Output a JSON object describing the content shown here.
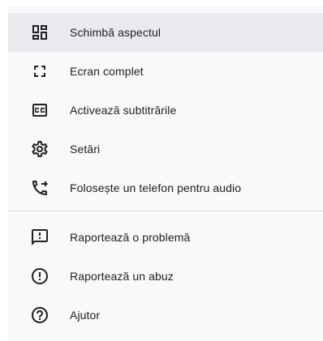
{
  "menu": {
    "items": [
      {
        "label": "Schimbă aspectul",
        "icon": "layout-icon",
        "active": true
      },
      {
        "label": "Ecran complet",
        "icon": "fullscreen-icon"
      },
      {
        "label": "Activează subtitrările",
        "icon": "closed-captions-icon"
      },
      {
        "label": "Setări",
        "icon": "settings-gear-icon"
      },
      {
        "label": "Folosește un telefon pentru audio",
        "icon": "phone-forward-icon"
      },
      {
        "label": "Raportează o problemă",
        "icon": "feedback-icon"
      },
      {
        "label": "Raportează un abuz",
        "icon": "report-abuse-icon"
      },
      {
        "label": "Ajutor",
        "icon": "help-icon"
      }
    ]
  },
  "colors": {
    "menu_background": "#f8f9fa",
    "active_item_background": "#e8eaed",
    "icon_color": "#202124",
    "divider": "#dadce0"
  }
}
